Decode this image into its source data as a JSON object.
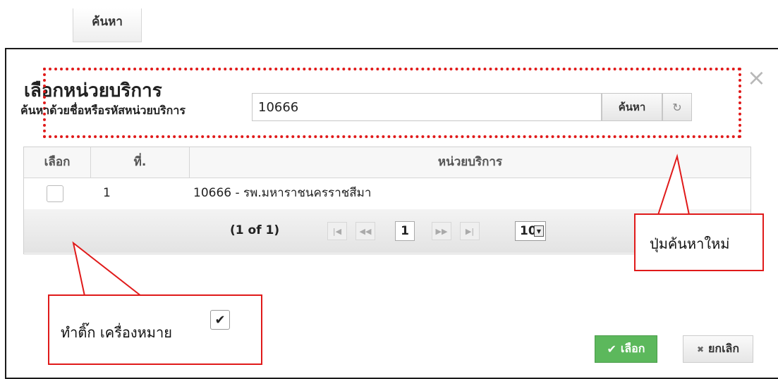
{
  "background": {
    "search_button_label": "ค้นหา"
  },
  "dialog": {
    "title": "เลือกหน่วยบริการ",
    "search": {
      "label": "ค้นหาด้วยชื่อหรือรหัสหน่วยบริการ",
      "value": "10666",
      "button_label": "ค้นหา"
    },
    "table": {
      "headers": {
        "select": "เลือก",
        "number": "ที่.",
        "unit": "หน่วยบริการ"
      },
      "rows": [
        {
          "number": "1",
          "unit": "10666 - รพ.มหาราชนครราชสีมา",
          "checked": false
        }
      ]
    },
    "paginator": {
      "status": "(1 of 1)",
      "current_page": "1",
      "rows_per_page": "10",
      "first_icon": "first-page-icon",
      "prev_icon": "prev-page-icon",
      "next_icon": "next-page-icon",
      "last_icon": "last-page-icon"
    },
    "footer": {
      "select_label": "เลือก",
      "cancel_label": "ยกเลิก"
    }
  },
  "annotations": {
    "refresh_callout": "ปุ่มค้นหาใหม่",
    "check_callout": "ทำติ๊ก เครื่องหมาย"
  },
  "colors": {
    "annotation_red": "#e01a1a",
    "select_button_green": "#5cb85c"
  }
}
